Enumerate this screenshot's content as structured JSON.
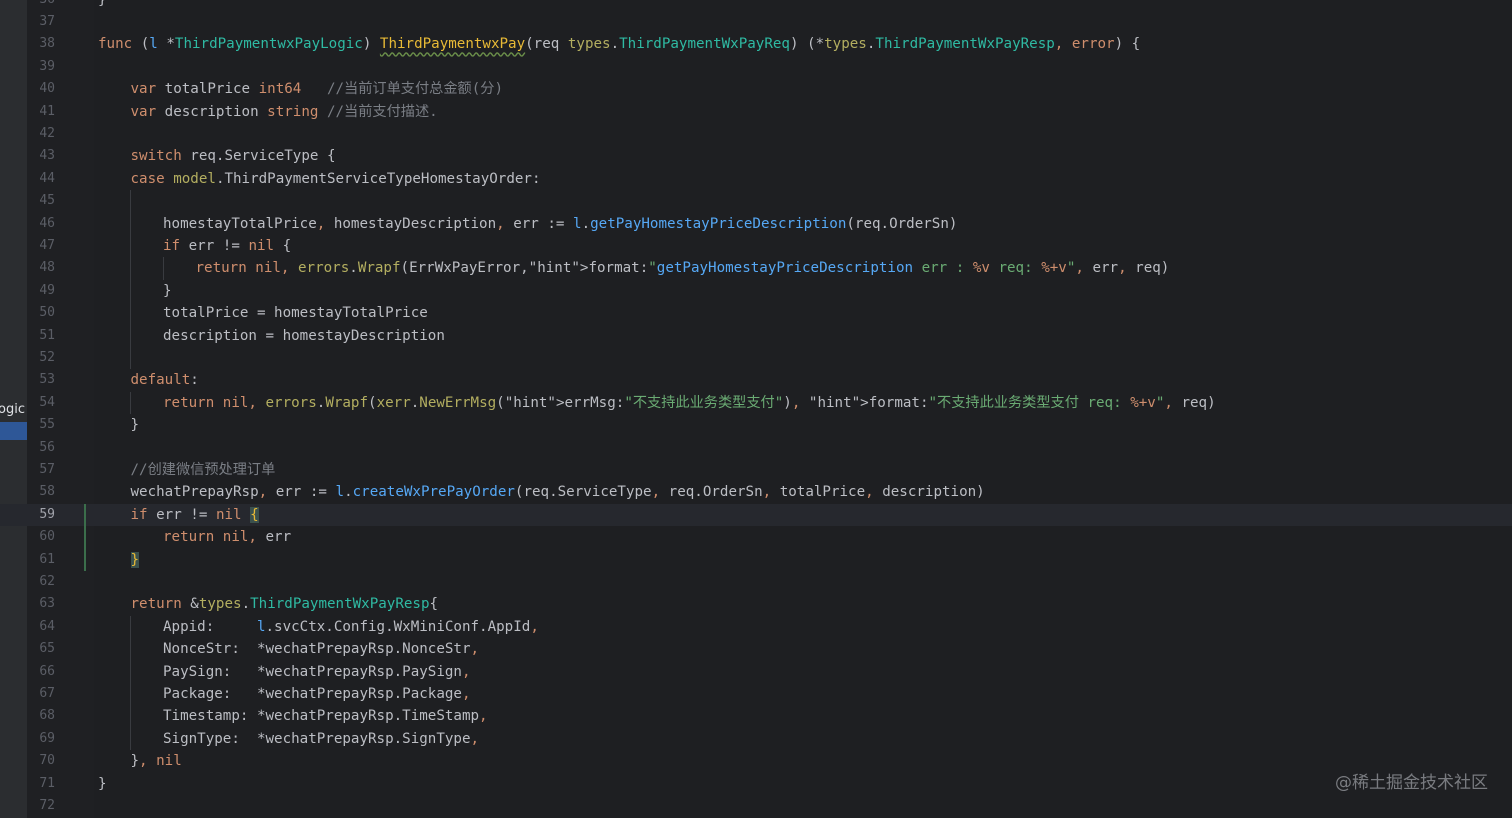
{
  "side_panel": {
    "label": "ogic"
  },
  "watermark": "@稀土掘金技术社区",
  "colors": {
    "editor_bg": "#1e1f22",
    "gutter_bg": "#1f2023",
    "keyword": "#cf8e6d",
    "string": "#6aab73",
    "comment": "#7a7e85",
    "type": "#2fbaa3",
    "function": "#56a8f5"
  },
  "current_line": "59",
  "lines": [
    {
      "n": "36",
      "text": "}"
    },
    {
      "n": "37",
      "text": ""
    },
    {
      "n": "38",
      "text": "func (l *ThirdPaymentwxPayLogic) ThirdPaymentwxPay(req types.ThirdPaymentWxPayReq) (*types.ThirdPaymentWxPayResp, error) {"
    },
    {
      "n": "39",
      "text": ""
    },
    {
      "n": "40",
      "text": "var totalPrice int64   //当前订单支付总金额(分)"
    },
    {
      "n": "41",
      "text": "var description string //当前支付描述."
    },
    {
      "n": "42",
      "text": ""
    },
    {
      "n": "43",
      "text": "switch req.ServiceType {"
    },
    {
      "n": "44",
      "text": "case model.ThirdPaymentServiceTypeHomestayOrder:"
    },
    {
      "n": "45",
      "text": ""
    },
    {
      "n": "46",
      "text": "homestayTotalPrice, homestayDescription, err := l.getPayHomestayPriceDescription(req.OrderSn)"
    },
    {
      "n": "47",
      "text": "if err != nil {"
    },
    {
      "n": "48",
      "text": "return nil, errors.Wrapf(ErrWxPayError, format: \"getPayHomestayPriceDescription err : %v req: %+v\", err, req)"
    },
    {
      "n": "49",
      "text": "}"
    },
    {
      "n": "50",
      "text": "totalPrice = homestayTotalPrice"
    },
    {
      "n": "51",
      "text": "description = homestayDescription"
    },
    {
      "n": "52",
      "text": ""
    },
    {
      "n": "53",
      "text": "default:"
    },
    {
      "n": "54",
      "text": "return nil, errors.Wrapf(xerr.NewErrMsg( errMsg: \"不支持此业务类型支付\"),  format: \"不支持此业务类型支付 req: %+v\", req)"
    },
    {
      "n": "55",
      "text": "}"
    },
    {
      "n": "56",
      "text": ""
    },
    {
      "n": "57",
      "text": "//创建微信预处理订单"
    },
    {
      "n": "58",
      "text": "wechatPrepayRsp, err := l.createWxPrePayOrder(req.ServiceType, req.OrderSn, totalPrice, description)"
    },
    {
      "n": "59",
      "text": "if err != nil {"
    },
    {
      "n": "60",
      "text": "return nil, err"
    },
    {
      "n": "61",
      "text": "}"
    },
    {
      "n": "62",
      "text": ""
    },
    {
      "n": "63",
      "text": "return &types.ThirdPaymentWxPayResp{"
    },
    {
      "n": "64",
      "text": "Appid:     l.svcCtx.Config.WxMiniConf.AppId,"
    },
    {
      "n": "65",
      "text": "NonceStr:  *wechatPrepayRsp.NonceStr,"
    },
    {
      "n": "66",
      "text": "PaySign:   *wechatPrepayRsp.PaySign,"
    },
    {
      "n": "67",
      "text": "Package:   *wechatPrepayRsp.Package,"
    },
    {
      "n": "68",
      "text": "Timestamp: *wechatPrepayRsp.TimeStamp,"
    },
    {
      "n": "69",
      "text": "SignType:  *wechatPrepayRsp.SignType,"
    },
    {
      "n": "70",
      "text": "}, nil"
    },
    {
      "n": "71",
      "text": "}"
    },
    {
      "n": "72",
      "text": ""
    }
  ]
}
